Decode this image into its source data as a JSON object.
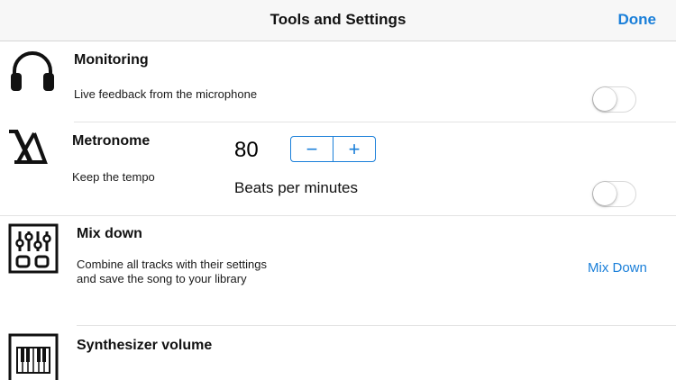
{
  "navbar": {
    "title": "Tools and Settings",
    "done_label": "Done"
  },
  "monitoring": {
    "title": "Monitoring",
    "description": "Live feedback from the microphone",
    "icon": "headphones-icon",
    "enabled": false
  },
  "metronome": {
    "title": "Metronome",
    "description": "Keep the tempo",
    "icon": "metronome-icon",
    "bpm": "80",
    "decrement_label": "−",
    "increment_label": "+",
    "unit_label": "Beats per minutes",
    "enabled": false
  },
  "mixdown": {
    "title": "Mix down",
    "description_line1": "Combine all tracks with their settings",
    "description_line2": "and save the song to your library",
    "action_label": "Mix Down",
    "icon": "mixer-icon"
  },
  "synthesizer": {
    "title": "Synthesizer volume",
    "icon": "piano-icon"
  },
  "colors": {
    "accent": "#1a7fd9",
    "separator": "#e3e3e3",
    "navbar_bg": "#f7f7f7"
  }
}
